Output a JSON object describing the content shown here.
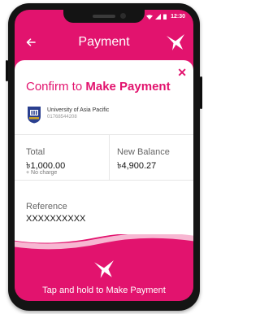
{
  "status_bar": {
    "time": "12:30"
  },
  "header": {
    "title": "Payment"
  },
  "dialog": {
    "title_prefix": "Confirm to ",
    "title_emphasis": "Make Payment",
    "merchant": {
      "name": "University of Asia Pacific",
      "number": "01768544208"
    },
    "total": {
      "label": "Total",
      "value": "৳1,000.00",
      "note": "+ No charge"
    },
    "new_balance": {
      "label": "New Balance",
      "value": "৳4,900.27"
    },
    "reference": {
      "label": "Reference",
      "value": "XXXXXXXXXX"
    }
  },
  "action": {
    "label": "Tap and hold to Make Payment"
  },
  "colors": {
    "brand": "#e2136e",
    "text": "#111111",
    "muted": "#666666"
  }
}
